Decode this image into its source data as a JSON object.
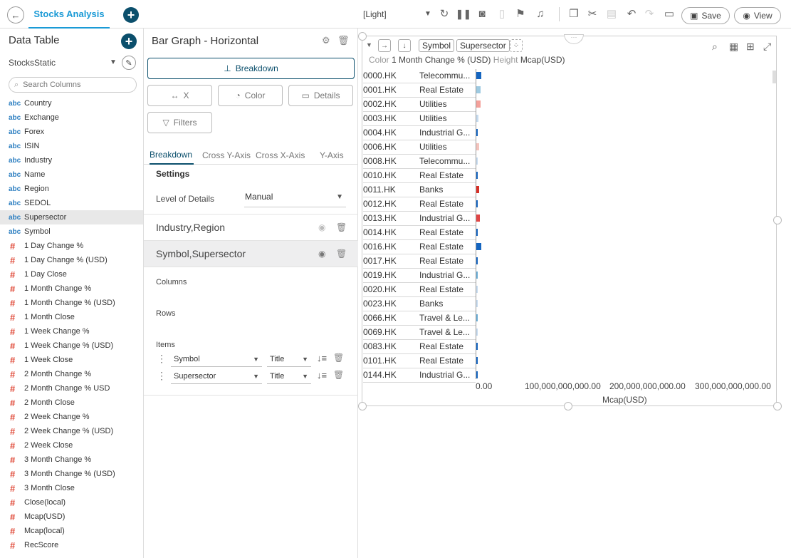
{
  "app": {
    "tab_title": "Stocks Analysis",
    "theme": "[Light]",
    "save_label": "Save",
    "view_label": "View"
  },
  "data_table": {
    "title": "Data Table",
    "dataset": "StocksStatic",
    "search_placeholder": "Search Columns",
    "text_type_label": "abc",
    "numeric_type_label": "#",
    "columns": [
      {
        "type": "text",
        "name": "Country"
      },
      {
        "type": "text",
        "name": "Exchange"
      },
      {
        "type": "text",
        "name": "Forex"
      },
      {
        "type": "text",
        "name": "ISIN"
      },
      {
        "type": "text",
        "name": "Industry"
      },
      {
        "type": "text",
        "name": "Name"
      },
      {
        "type": "text",
        "name": "Region"
      },
      {
        "type": "text",
        "name": "SEDOL"
      },
      {
        "type": "text",
        "name": "Supersector",
        "selected": true
      },
      {
        "type": "text",
        "name": "Symbol"
      },
      {
        "type": "numeric",
        "name": "1 Day Change %"
      },
      {
        "type": "numeric",
        "name": "1 Day Change % (USD)"
      },
      {
        "type": "numeric",
        "name": "1 Day Close"
      },
      {
        "type": "numeric",
        "name": "1 Month Change %"
      },
      {
        "type": "numeric",
        "name": "1 Month Change % (USD)"
      },
      {
        "type": "numeric",
        "name": "1 Month Close"
      },
      {
        "type": "numeric",
        "name": "1 Week Change %"
      },
      {
        "type": "numeric",
        "name": "1 Week Change % (USD)"
      },
      {
        "type": "numeric",
        "name": "1 Week Close"
      },
      {
        "type": "numeric",
        "name": "2 Month Change %"
      },
      {
        "type": "numeric",
        "name": "2 Month Change % USD"
      },
      {
        "type": "numeric",
        "name": "2 Month Close"
      },
      {
        "type": "numeric",
        "name": "2 Week Change %"
      },
      {
        "type": "numeric",
        "name": "2 Week Change % (USD)"
      },
      {
        "type": "numeric",
        "name": "2 Week Close"
      },
      {
        "type": "numeric",
        "name": "3 Month Change %"
      },
      {
        "type": "numeric",
        "name": "3 Month Change % (USD)"
      },
      {
        "type": "numeric",
        "name": "3 Month Close"
      },
      {
        "type": "numeric",
        "name": "Close(local)"
      },
      {
        "type": "numeric",
        "name": "Mcap(USD)"
      },
      {
        "type": "numeric",
        "name": "Mcap(local)"
      },
      {
        "type": "numeric",
        "name": "RecScore"
      }
    ]
  },
  "settings_panel": {
    "title": "Bar Graph - Horizontal",
    "breakdown_button": "Breakdown",
    "x_button": "X",
    "color_button": "Color",
    "details_button": "Details",
    "filters_button": "Filters",
    "tabs": [
      "Breakdown",
      "Cross Y-Axis",
      "Cross X-Axis",
      "Y-Axis"
    ],
    "settings_heading": "Settings",
    "level_of_details_label": "Level of Details",
    "level_of_details_value": "Manual",
    "breakdowns": [
      "Industry,Region",
      "Symbol,Supersector"
    ],
    "columns_label": "Columns",
    "rows_label": "Rows",
    "items_label": "Items",
    "items": [
      {
        "field": "Symbol",
        "display": "Title"
      },
      {
        "field": "Supersector",
        "display": "Title"
      }
    ]
  },
  "chart": {
    "chip_symbol": "Symbol",
    "chip_supersector": "Supersector",
    "legend_color_label": "Color",
    "legend_color_value": "1 Month Change % (USD)",
    "legend_height_label": "Height",
    "legend_height_value": "Mcap(USD)"
  },
  "chart_data": {
    "type": "bar",
    "orientation": "horizontal",
    "xlabel": "Mcap(USD)",
    "x_ticks": [
      "0.00",
      "100,000,000,000.00",
      "200,000,000,000.00",
      "300,000,000,000.00"
    ],
    "xlim": [
      0,
      350000000000
    ],
    "color_field": "1 Month Change % (USD)",
    "rows": [
      {
        "symbol": "0000.HK",
        "supersector": "Telecommu...",
        "value": 5500000000,
        "color": "#1565c0"
      },
      {
        "symbol": "0001.HK",
        "supersector": "Real Estate",
        "value": 5000000000,
        "color": "#9ecae1"
      },
      {
        "symbol": "0002.HK",
        "supersector": "Utilities",
        "value": 4800000000,
        "color": "#f4a09a"
      },
      {
        "symbol": "0003.HK",
        "supersector": "Utilities",
        "value": 2800000000,
        "color": "#c6dbef"
      },
      {
        "symbol": "0004.HK",
        "supersector": "Industrial G...",
        "value": 1200000000,
        "color": "#1565c0"
      },
      {
        "symbol": "0006.HK",
        "supersector": "Utilities",
        "value": 3500000000,
        "color": "#f5c4bd"
      },
      {
        "symbol": "0008.HK",
        "supersector": "Telecommu...",
        "value": 900000000,
        "color": "#c6dbef"
      },
      {
        "symbol": "0010.HK",
        "supersector": "Real Estate",
        "value": 1000000000,
        "color": "#1565c0"
      },
      {
        "symbol": "0011.HK",
        "supersector": "Banks",
        "value": 3100000000,
        "color": "#d73027"
      },
      {
        "symbol": "0012.HK",
        "supersector": "Real Estate",
        "value": 1500000000,
        "color": "#1565c0"
      },
      {
        "symbol": "0013.HK",
        "supersector": "Industrial G...",
        "value": 4400000000,
        "color": "#e04646"
      },
      {
        "symbol": "0014.HK",
        "supersector": "Real Estate",
        "value": 600000000,
        "color": "#1565c0"
      },
      {
        "symbol": "0016.HK",
        "supersector": "Real Estate",
        "value": 5600000000,
        "color": "#1565c0"
      },
      {
        "symbol": "0017.HK",
        "supersector": "Real Estate",
        "value": 1200000000,
        "color": "#1565c0"
      },
      {
        "symbol": "0019.HK",
        "supersector": "Industrial G...",
        "value": 1500000000,
        "color": "#6baed6"
      },
      {
        "symbol": "0020.HK",
        "supersector": "Real Estate",
        "value": 800000000,
        "color": "#c6dbef"
      },
      {
        "symbol": "0023.HK",
        "supersector": "Banks",
        "value": 1000000000,
        "color": "#c6dbef"
      },
      {
        "symbol": "0066.HK",
        "supersector": "Travel & Le...",
        "value": 1500000000,
        "color": "#6baed6"
      },
      {
        "symbol": "0069.HK",
        "supersector": "Travel & Le...",
        "value": 900000000,
        "color": "#c6dbef"
      },
      {
        "symbol": "0083.HK",
        "supersector": "Real Estate",
        "value": 1000000000,
        "color": "#1565c0"
      },
      {
        "symbol": "0101.HK",
        "supersector": "Real Estate",
        "value": 1500000000,
        "color": "#1565c0"
      },
      {
        "symbol": "0144.HK",
        "supersector": "Industrial G...",
        "value": 1200000000,
        "color": "#1565c0"
      }
    ]
  }
}
